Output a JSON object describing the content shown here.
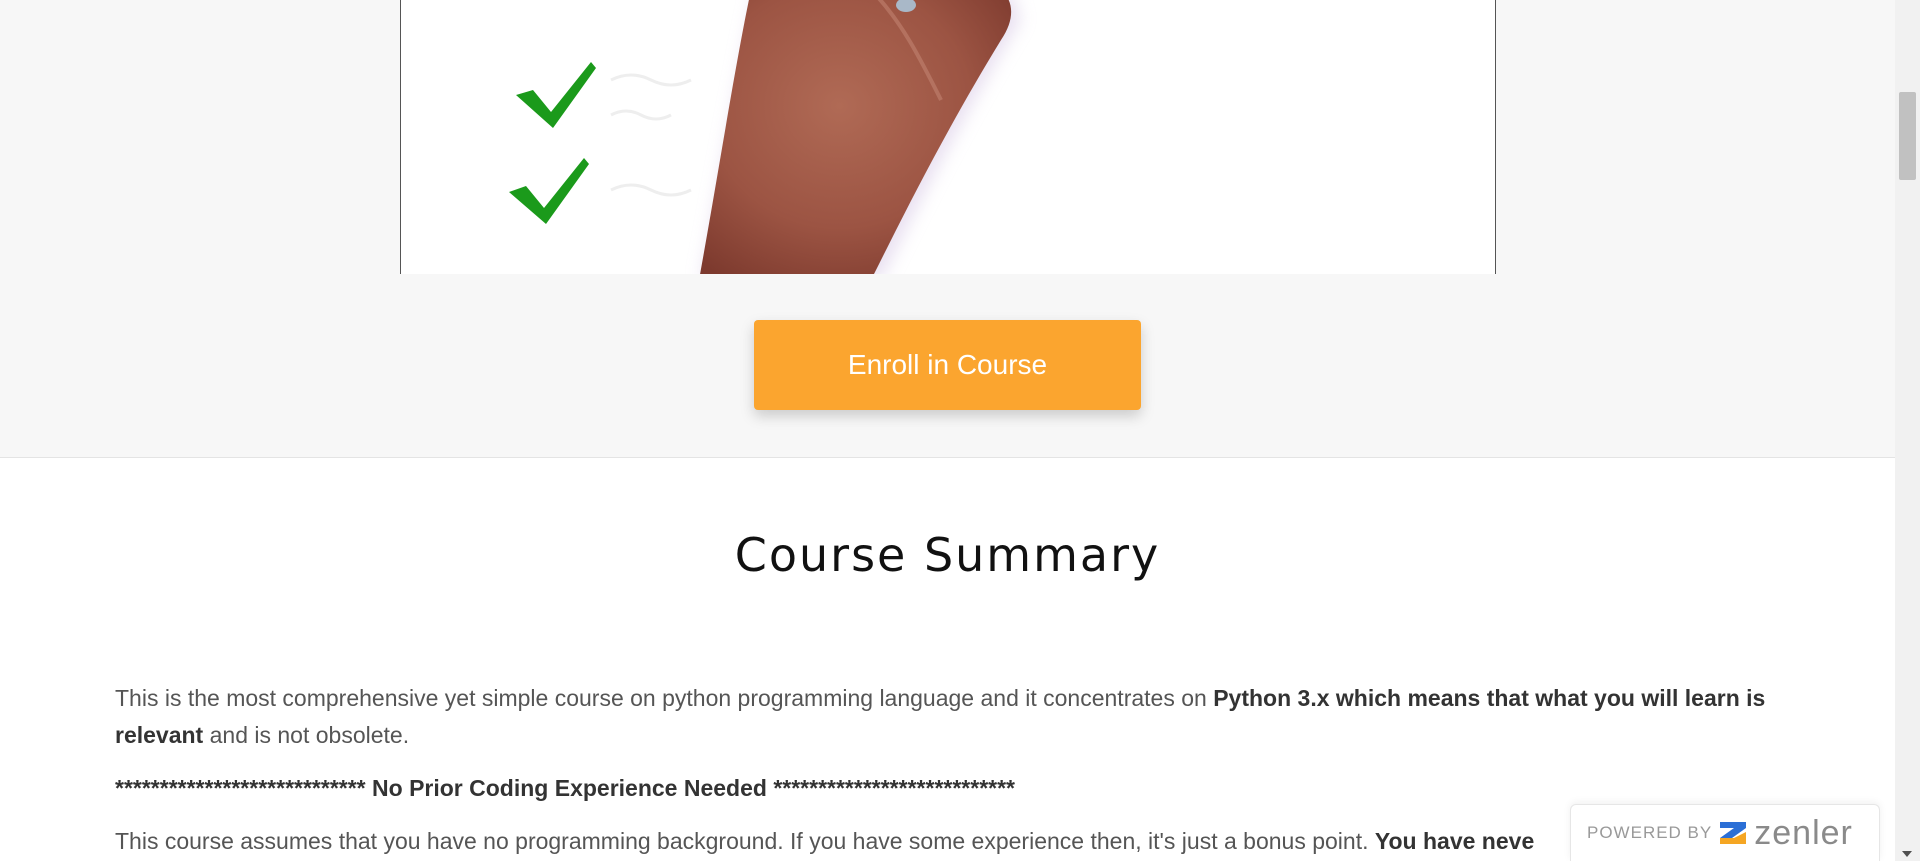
{
  "enroll": {
    "label": "Enroll in Course"
  },
  "summary": {
    "title": "Course Summary",
    "p1_text1": "This is the most comprehensive yet simple course on python programming language and it concentrates on ",
    "p1_bold": "Python 3.x which means that what you will learn is relevant",
    "p1_text2": " and is not obsolete.",
    "stars_left": "**************************** ",
    "stars_middle": "No Prior Coding Experience Needed",
    "stars_right": " ***************************",
    "p3_text": "This course assumes that you have no programming background. If you have some experience then, it's just a bonus point. ",
    "p3_bold": "You have neve"
  },
  "badge": {
    "powered_label": "POWERED BY",
    "brand": "zenler"
  },
  "colors": {
    "enroll_button": "#fba52f",
    "checkmark": "#1b9a1b",
    "badge_logo_blue": "#2b6fd6",
    "badge_logo_orange": "#f5a623"
  },
  "icons": {
    "checkmark": "checkmark-icon",
    "zenler_logo": "zenler-logo-icon"
  }
}
